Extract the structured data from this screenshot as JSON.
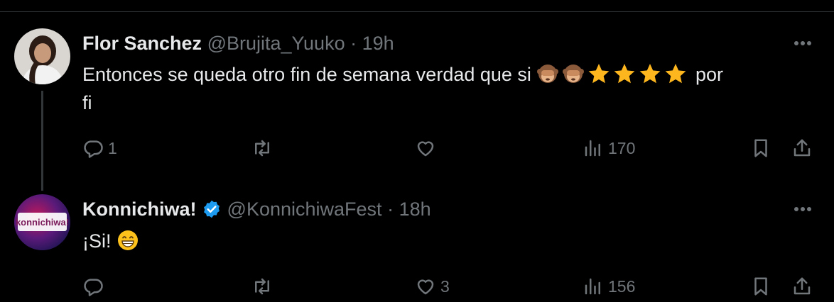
{
  "tweets": [
    {
      "name": "Flor Sanchez",
      "verified": false,
      "handle": "@Brujita_Yuuko",
      "separator": "·",
      "time": "19h",
      "text_main": "Entonces se queda otro fin de semana verdad que si",
      "text_emojis": [
        "see-no-evil-monkey",
        "see-no-evil-monkey",
        "star",
        "star",
        "star",
        "star"
      ],
      "text_tail": "por",
      "text_wrap": "fi",
      "replies": "1",
      "reposts": "",
      "likes": "",
      "views": "170"
    },
    {
      "name": "Konnichiwa!",
      "verified": true,
      "handle": "@KonnichiwaFest",
      "separator": "·",
      "time": "18h",
      "text_main": "¡Si!",
      "text_emojis": [
        "grinning-face"
      ],
      "replies": "",
      "reposts": "",
      "likes": "3",
      "views": "156"
    }
  ],
  "avatar2_logo_text": "konnichiwa!",
  "colors": {
    "background": "#000000",
    "text": "#e7e9ea",
    "muted": "#71767b",
    "verified": "#1d9bf0",
    "divider": "#2f3336"
  }
}
